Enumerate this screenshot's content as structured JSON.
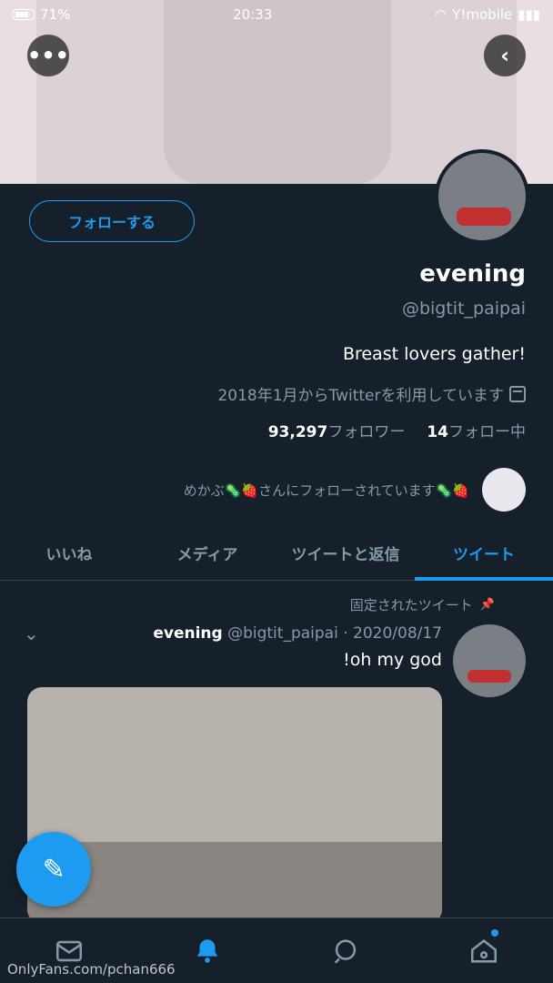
{
  "status_bar": {
    "carrier": "Y!mobile",
    "time": "20:33",
    "battery": "71%"
  },
  "profile": {
    "follow_label": "フォローする",
    "name": "evening",
    "handle": "@bigtit_paipai",
    "bio": "Breast lovers gather!",
    "joined": "2018年1月からTwitterを利用しています",
    "following_count": "14",
    "following_label": "フォロー中",
    "followers_count": "93,297",
    "followers_label": "フォロワー",
    "followed_by": "🍓🦠めかぶ🦠🍓さんにフォローされています"
  },
  "tabs": [
    {
      "label": "ツイート"
    },
    {
      "label": "ツイートと返信"
    },
    {
      "label": "メディア"
    },
    {
      "label": "いいね"
    }
  ],
  "tweet": {
    "pinned_label": "固定されたツイート",
    "name": "evening",
    "meta": "@bigtit_paipai · 2020/08/17",
    "text": "oh my god!"
  },
  "watermark": "OnlyFans.com/pchan666",
  "colors": {
    "accent": "#1d9bf0",
    "background": "#15202b",
    "muted": "#8899a6"
  }
}
